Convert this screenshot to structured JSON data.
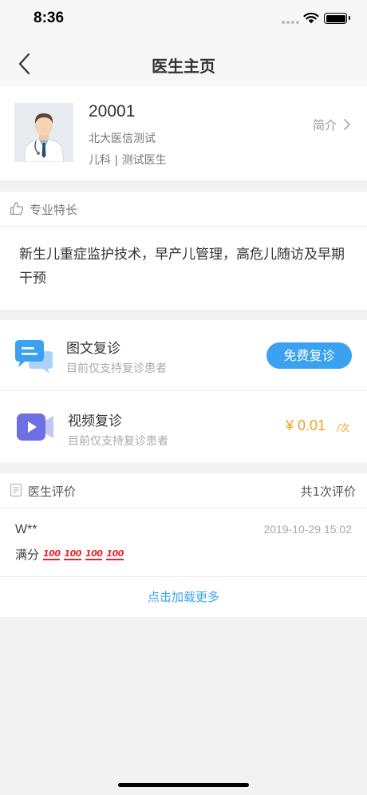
{
  "status_bar": {
    "time": "8:36"
  },
  "nav": {
    "title": "医生主页"
  },
  "doctor": {
    "id": "20001",
    "organization": "北大医信测试",
    "department": "儿科 | 测试医生",
    "intro_label": "简介"
  },
  "specialty": {
    "label": "专业特长",
    "text": "新生儿重症监护技术，早产儿管理，高危儿随访及早期干预"
  },
  "services": [
    {
      "title": "图文复诊",
      "subtitle": "目前仅支持复诊患者",
      "action_label": "免费复诊"
    },
    {
      "title": "视频复诊",
      "subtitle": "目前仅支持复诊患者",
      "price": "¥ 0.01",
      "price_unit": "/次"
    }
  ],
  "reviews": {
    "label": "医生评价",
    "count_text": "共1次评价",
    "items": [
      {
        "user": "W**",
        "date": "2019-10-29 15:02",
        "text": "满分",
        "badge": "100"
      }
    ],
    "load_more_label": "点击加载更多"
  },
  "colors": {
    "accent": "#3ba2f2",
    "price": "#f5a021",
    "background": "#f2f2f2"
  }
}
